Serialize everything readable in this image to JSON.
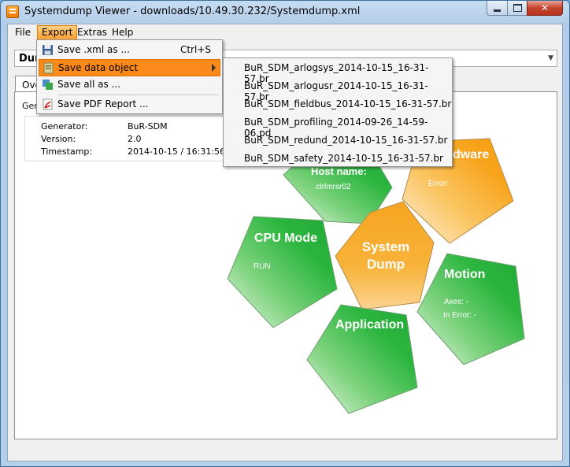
{
  "window": {
    "title": "Systemdump Viewer - downloads/10.49.30.232/Systemdump.xml"
  },
  "menubar": {
    "file": "File",
    "export": "Export",
    "extras": "Extras",
    "help": "Help"
  },
  "combo": {
    "value": "Dun"
  },
  "tab": {
    "label": "Ove"
  },
  "group": {
    "label": "Gen"
  },
  "info": [
    {
      "key": "Generator:",
      "value": "BuR-SDM"
    },
    {
      "key": "Version:",
      "value": "2.0"
    },
    {
      "key": "Timestamp:",
      "value": "2014-10-15 / 16:31:56"
    }
  ],
  "export_menu": {
    "save_xml": "Save .xml as ...",
    "save_xml_shortcut": "Ctrl+S",
    "save_data_object": "Save data object",
    "save_all": "Save all as ...",
    "save_pdf": "Save PDF Report ..."
  },
  "submenu": [
    "BuR_SDM_arlogsys_2014-10-15_16-31-57.br",
    "BuR_SDM_arlogusr_2014-10-15_16-31-57.br",
    "BuR_SDM_fieldbus_2014-10-15_16-31-57.br",
    "BuR_SDM_profiling_2014-09-26_14-59-06.pd",
    "BuR_SDM_redund_2014-10-15_16-31-57.br",
    "BuR_SDM_safety_2014-10-15_16-31-57.br"
  ],
  "diagram": {
    "center": {
      "line1": "System",
      "line2": "Dump"
    },
    "host": {
      "title": "Host name:",
      "value": "ctrlmrsr02"
    },
    "hardware": {
      "title": "dware",
      "value": "Error!"
    },
    "cpu": {
      "title": "CPU Mode",
      "value": "RUN"
    },
    "motion": {
      "title": "Motion",
      "axes": "Axes: -",
      "error": "In Error: -"
    },
    "application": {
      "title": "Application"
    }
  },
  "colors": {
    "green": "#27b53e",
    "orange": "#f7a21b",
    "highlight": "#fb8a1a"
  }
}
